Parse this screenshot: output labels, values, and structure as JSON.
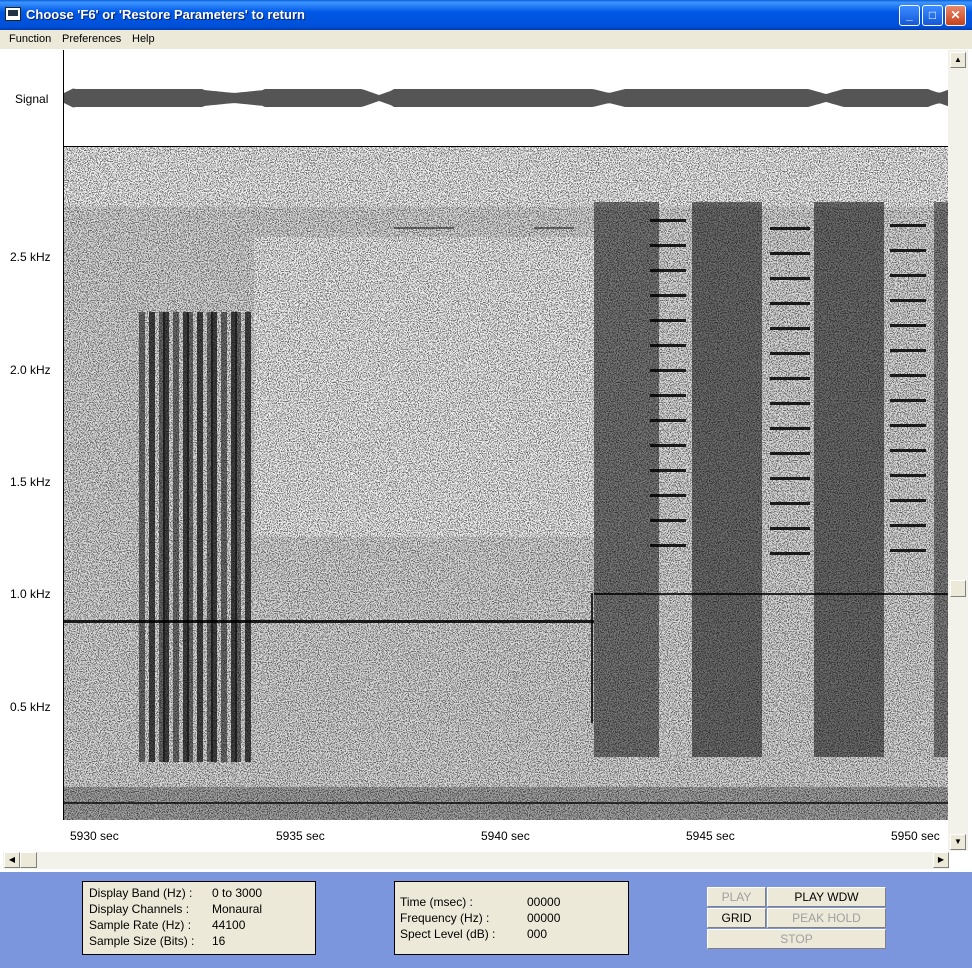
{
  "window": {
    "title": "Choose 'F6' or 'Restore Parameters' to return",
    "minimize": "_",
    "maximize": "□",
    "close": "✕"
  },
  "menu": [
    "Function",
    "Preferences",
    "Help"
  ],
  "signal_label": "Signal",
  "freq_labels": [
    "2.5 kHz",
    "2.0 kHz",
    "1.5 kHz",
    "1.0 kHz",
    "0.5 kHz"
  ],
  "time_labels": [
    "5930 sec",
    "5935 sec",
    "5940 sec",
    "5945 sec",
    "5950 sec"
  ],
  "info_panel": {
    "rows": [
      {
        "label": "Display Band (Hz) :",
        "value": "0 to 3000"
      },
      {
        "label": "Display Channels :",
        "value": "Monaural"
      },
      {
        "label": "Sample Rate (Hz) :",
        "value": "44100"
      },
      {
        "label": "Sample Size (Bits) :",
        "value": "16"
      }
    ]
  },
  "cursor_panel": {
    "rows": [
      {
        "label": "Time (msec) :",
        "value": "00000"
      },
      {
        "label": "Frequency (Hz) :",
        "value": "00000"
      },
      {
        "label": "Spect Level (dB) :",
        "value": "000"
      }
    ]
  },
  "buttons": {
    "play": "PLAY",
    "play_wdw": "PLAY WDW",
    "grid": "GRID",
    "peak_hold": "PEAK HOLD",
    "stop": "STOP"
  },
  "colors": {
    "titlebar": "#0054e3",
    "bottom_area": "#7b96dc",
    "panel": "#ece9d8",
    "waveform": "#555555",
    "spectrogram_ink": "#000000"
  }
}
